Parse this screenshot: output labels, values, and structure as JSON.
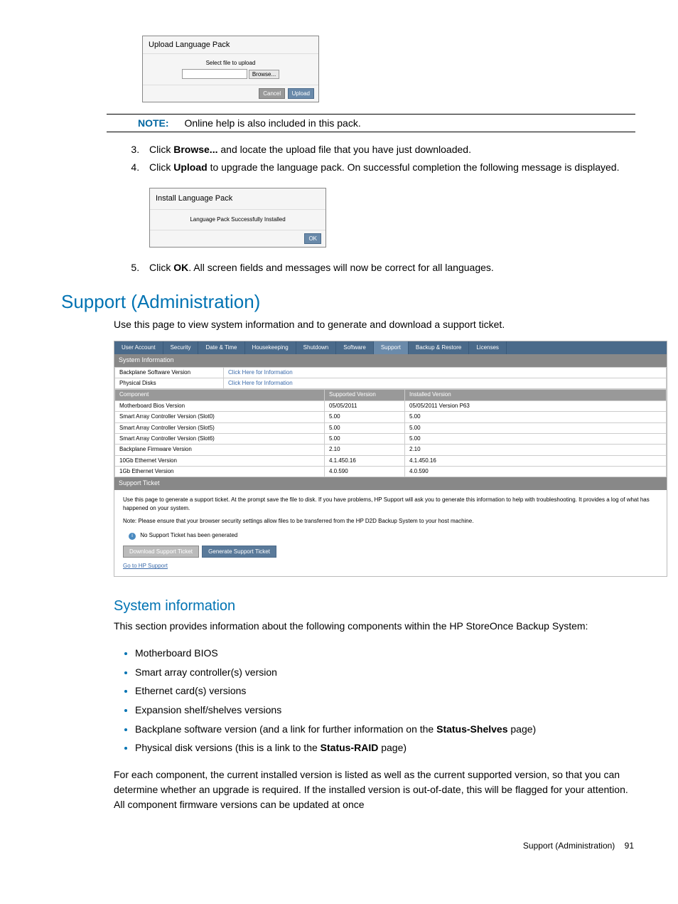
{
  "dialog1": {
    "title": "Upload Language Pack",
    "body_text": "Select file to upload",
    "browse": "Browse...",
    "cancel": "Cancel",
    "upload": "Upload"
  },
  "note": {
    "label": "NOTE:",
    "text": "Online help is also included in this pack."
  },
  "steps": {
    "s3_a": "Click ",
    "s3_b": "Browse...",
    "s3_c": " and locate the upload file that you have just downloaded.",
    "s4_a": "Click ",
    "s4_b": "Upload",
    "s4_c": " to upgrade the language pack. On successful completion the following message is displayed.",
    "s5_a": "Click ",
    "s5_b": "OK",
    "s5_c": ". All screen fields and messages will now be correct for all languages."
  },
  "dialog2": {
    "title": "Install Language Pack",
    "body_text": "Language Pack Successfully Installed",
    "ok": "OK"
  },
  "h1": "Support (Administration)",
  "p1": "Use this page to view system information and to generate and download a support ticket.",
  "tabs": [
    "User Account",
    "Security",
    "Date & Time",
    "Housekeeping",
    "Shutdown",
    "Software",
    "Support",
    "Backup & Restore",
    "Licenses"
  ],
  "panel1": "System Information",
  "row1": {
    "label": "Backplane Software Version",
    "value": "Click Here for Information"
  },
  "row2": {
    "label": "Physical Disks",
    "value": "Click Here for Information"
  },
  "cols": {
    "c1": "Component",
    "c2": "Supported Version",
    "c3": "Installed Version"
  },
  "rows": [
    {
      "c1": "Motherboard Bios Version",
      "c2": "05/05/2011",
      "c3": "05/05/2011 Version P63"
    },
    {
      "c1": "Smart Array Controller Version (Slot0)",
      "c2": "5.00",
      "c3": "5.00"
    },
    {
      "c1": "Smart Array Controller Version (Slot5)",
      "c2": "5.00",
      "c3": "5.00"
    },
    {
      "c1": "Smart Array Controller Version (Slot6)",
      "c2": "5.00",
      "c3": "5.00"
    },
    {
      "c1": "Backplane Firmware Version",
      "c2": "2.10",
      "c3": "2.10"
    },
    {
      "c1": "10Gb Ethernet Version",
      "c2": "4.1.450.16",
      "c3": "4.1.450.16"
    },
    {
      "c1": "1Gb Ethernet Version",
      "c2": "4.0.590",
      "c3": "4.0.590"
    }
  ],
  "panel2": "Support Ticket",
  "ticket": {
    "p1": "Use this page to generate a support ticket. At the prompt save the file to disk. If you have problems, HP Support will ask you to generate this information to help with troubleshooting. It provides a log of what has happened on your system.",
    "p2": "Note: Please ensure that your browser security settings allow files to be transferred from the HP D2D Backup System to your host machine.",
    "p3": "No Support Ticket has been generated",
    "btn1": "Download Support Ticket",
    "btn2": "Generate Support Ticket",
    "link": "Go to HP Support"
  },
  "h2": "System information",
  "p2": "This section provides information about the following components within the HP StoreOnce Backup System:",
  "bullets": [
    {
      "t": "Motherboard BIOS"
    },
    {
      "t": "Smart array controller(s) version"
    },
    {
      "t": "Ethernet card(s) versions"
    },
    {
      "t": "Expansion shelf/shelves versions"
    },
    {
      "t1": "Backplane software version (and a link for further information on the ",
      "b": "Status-Shelves",
      "t2": " page)"
    },
    {
      "t1": "Physical disk versions (this is a link to the ",
      "b": "Status-RAID",
      "t2": " page)"
    }
  ],
  "p3": "For each component, the current installed version is listed as well as the current supported version, so that you can determine whether an upgrade is required. If the installed version is out-of-date, this will be flagged for your attention. All component firmware versions can be updated at once",
  "footer": {
    "text": "Support (Administration)",
    "page": "91"
  }
}
